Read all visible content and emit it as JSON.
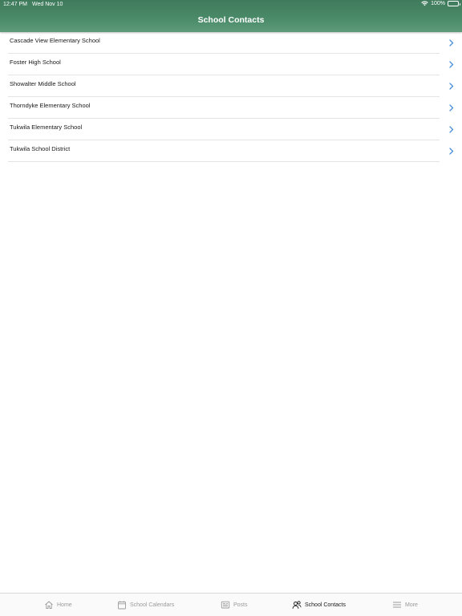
{
  "status_bar": {
    "time": "12:47 PM",
    "date": "Wed Nov 10",
    "battery": "100%"
  },
  "nav": {
    "title": "School Contacts"
  },
  "contacts": [
    {
      "name": "Cascade View Elementary School"
    },
    {
      "name": "Foster High School"
    },
    {
      "name": "Showalter Middle School"
    },
    {
      "name": "Thorndyke Elementary School"
    },
    {
      "name": "Tukwila Elementary School"
    },
    {
      "name": "Tukwila School District"
    }
  ],
  "colors": {
    "header": "#4a8a68",
    "chevron": "#4a90d9",
    "active_tab": "#1a1a1a",
    "inactive_tab": "#9a9a9a"
  },
  "tabs": [
    {
      "label": "Home",
      "icon": "home-icon",
      "active": false
    },
    {
      "label": "School Calendars",
      "icon": "calendar-icon",
      "active": false
    },
    {
      "label": "Posts",
      "icon": "newspaper-icon",
      "active": false
    },
    {
      "label": "School Contacts",
      "icon": "contacts-icon",
      "active": true
    },
    {
      "label": "More",
      "icon": "menu-icon",
      "active": false
    }
  ]
}
